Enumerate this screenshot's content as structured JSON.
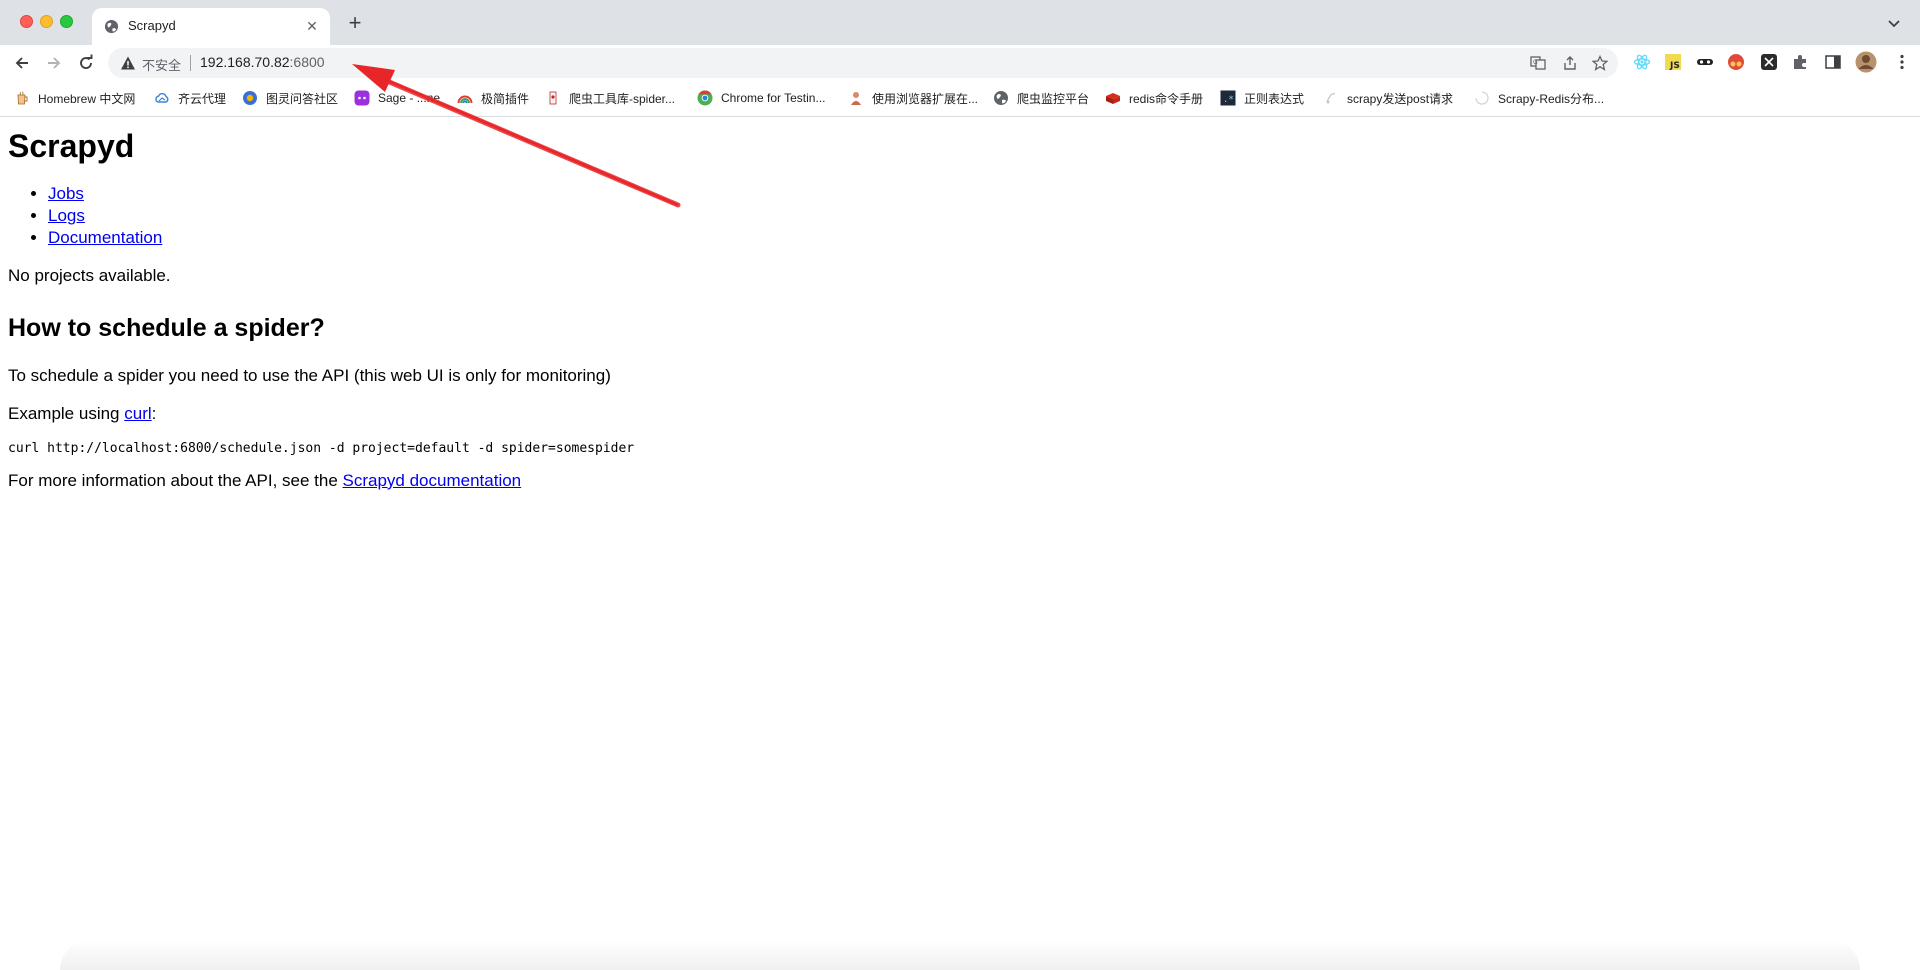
{
  "browser": {
    "tab": {
      "title": "Scrapyd",
      "favicon": "globe-icon"
    },
    "new_tab_label": "+",
    "address_bar": {
      "security_label": "不安全",
      "url_host": "192.168.70.82",
      "url_port": ":6800"
    },
    "bookmarks": [
      {
        "label": "Homebrew 中文网",
        "icon": "homebrew-icon"
      },
      {
        "label": "齐云代理",
        "icon": "cloud-icon"
      },
      {
        "label": "图灵问答社区",
        "icon": "turing-icon"
      },
      {
        "label": "Sage - ...ne",
        "icon": "sage-icon"
      },
      {
        "label": "极简插件",
        "icon": "rainbow-icon"
      },
      {
        "label": "爬虫工具库-spider...",
        "icon": "spider-icon"
      },
      {
        "label": "Chrome for Testin...",
        "icon": "chrome-icon"
      },
      {
        "label": "使用浏览器扩展在...",
        "icon": "person-icon"
      },
      {
        "label": "爬虫监控平台",
        "icon": "globe-icon"
      },
      {
        "label": "redis命令手册",
        "icon": "redis-icon"
      },
      {
        "label": "正则表达式",
        "icon": "regex-icon"
      },
      {
        "label": "scrapy发送post请求",
        "icon": "scrapy-icon"
      },
      {
        "label": "Scrapy-Redis分布...",
        "icon": "loading-icon"
      }
    ]
  },
  "page": {
    "title": "Scrapyd",
    "nav": [
      {
        "label": "Jobs"
      },
      {
        "label": "Logs"
      },
      {
        "label": "Documentation"
      }
    ],
    "no_projects": "No projects available.",
    "schedule_heading": "How to schedule a spider?",
    "schedule_text": "To schedule a spider you need to use the API (this web UI is only for monitoring)",
    "example_prefix": "Example using ",
    "example_link": "curl",
    "example_suffix": ":",
    "curl_command": "curl http://localhost:6800/schedule.json -d project=default -d spider=somespider",
    "more_info_prefix": "For more information about the API, see the ",
    "more_info_link": "Scrapyd documentation"
  },
  "annotation": {
    "color": "#e8262a",
    "icon": "red-arrow"
  }
}
